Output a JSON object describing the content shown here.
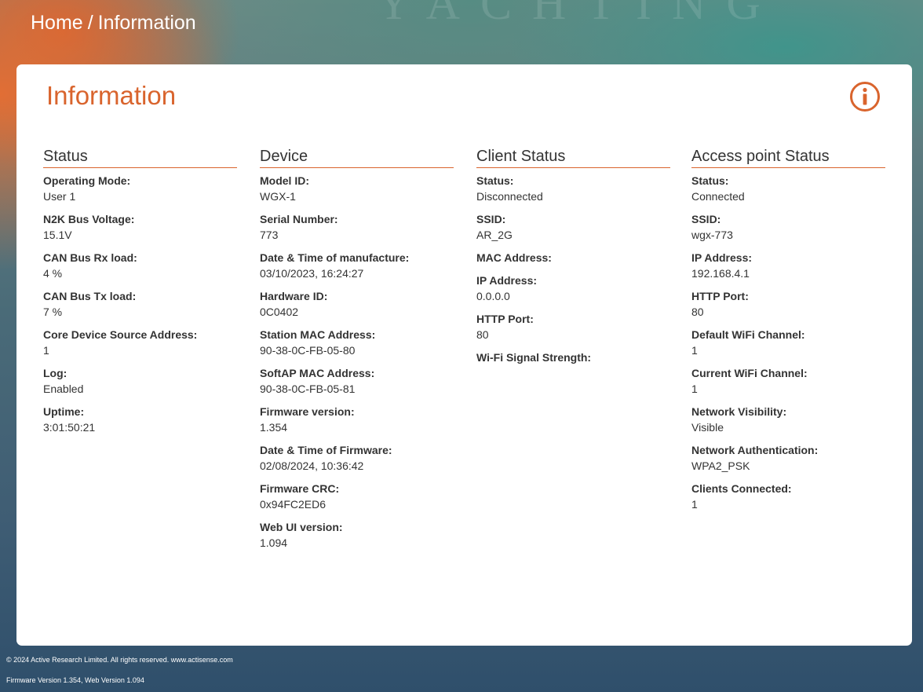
{
  "breadcrumb": {
    "home": "Home",
    "separator": "/",
    "current": "Information"
  },
  "watermark": "YACHTING",
  "card": {
    "title": "Information",
    "icon": "info-icon",
    "accent_color": "#d9642d"
  },
  "columns": [
    {
      "heading": "Status",
      "fields": [
        {
          "label": "Operating Mode:",
          "value": "User 1"
        },
        {
          "label": "N2K Bus Voltage:",
          "value": "15.1V"
        },
        {
          "label": "CAN Bus Rx load:",
          "value": "4 %"
        },
        {
          "label": "CAN Bus Tx load:",
          "value": "7 %"
        },
        {
          "label": "Core Device Source Address:",
          "value": "1"
        },
        {
          "label": "Log:",
          "value": "Enabled"
        },
        {
          "label": "Uptime:",
          "value": "3:01:50:21"
        }
      ]
    },
    {
      "heading": "Device",
      "fields": [
        {
          "label": "Model ID:",
          "value": "WGX-1"
        },
        {
          "label": "Serial Number:",
          "value": "773"
        },
        {
          "label": "Date & Time of manufacture:",
          "value": "03/10/2023, 16:24:27"
        },
        {
          "label": "Hardware ID:",
          "value": "0C0402"
        },
        {
          "label": "Station MAC Address:",
          "value": "90-38-0C-FB-05-80"
        },
        {
          "label": "SoftAP MAC Address:",
          "value": "90-38-0C-FB-05-81"
        },
        {
          "label": "Firmware version:",
          "value": "1.354"
        },
        {
          "label": "Date & Time of Firmware:",
          "value": "02/08/2024, 10:36:42"
        },
        {
          "label": "Firmware CRC:",
          "value": "0x94FC2ED6"
        },
        {
          "label": "Web UI version:",
          "value": "1.094"
        }
      ]
    },
    {
      "heading": "Client Status",
      "fields": [
        {
          "label": "Status:",
          "value": "Disconnected"
        },
        {
          "label": "SSID:",
          "value": "AR_2G"
        },
        {
          "label": "MAC Address:",
          "value": ""
        },
        {
          "label": "IP Address:",
          "value": "0.0.0.0"
        },
        {
          "label": "HTTP Port:",
          "value": "80"
        },
        {
          "label": "Wi-Fi Signal Strength:",
          "value": ""
        }
      ]
    },
    {
      "heading": "Access point Status",
      "fields": [
        {
          "label": "Status:",
          "value": "Connected"
        },
        {
          "label": "SSID:",
          "value": "wgx-773"
        },
        {
          "label": "IP Address:",
          "value": "192.168.4.1"
        },
        {
          "label": "HTTP Port:",
          "value": "80"
        },
        {
          "label": "Default WiFi Channel:",
          "value": "1"
        },
        {
          "label": "Current WiFi Channel:",
          "value": "1"
        },
        {
          "label": "Network Visibility:",
          "value": "Visible"
        },
        {
          "label": "Network Authentication:",
          "value": "WPA2_PSK"
        },
        {
          "label": "Clients Connected:",
          "value": "1"
        }
      ]
    }
  ],
  "footer": {
    "copyright": "© 2024 Active Research Limited. All rights reserved.",
    "website": "www.actisense.com",
    "versions": "Firmware Version 1.354, Web Version 1.094"
  }
}
